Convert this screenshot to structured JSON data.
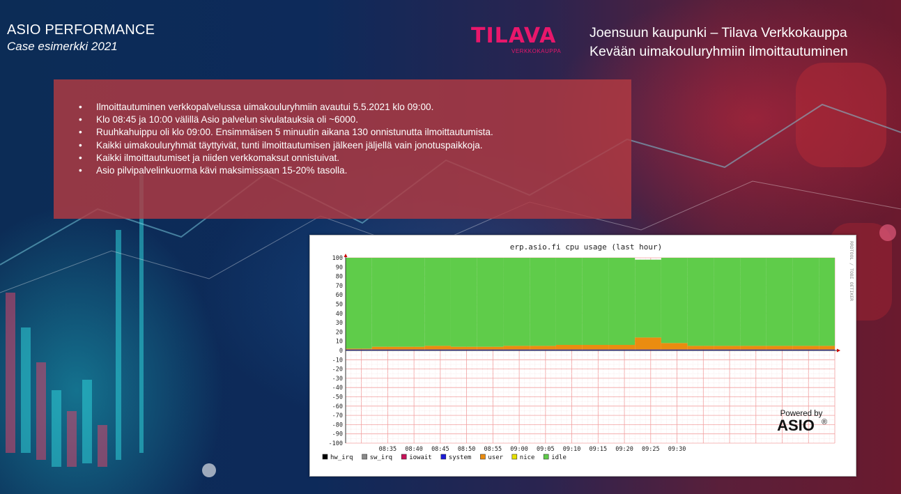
{
  "header": {
    "title": "ASIO PERFORMANCE",
    "subtitle": "Case esimerkki 2021",
    "right_line1": "Joensuun kaupunki – Tilava Verkkokauppa",
    "right_line2": "Kevään uimakouluryhmiin ilmoittautuminen"
  },
  "logo": {
    "text": "TILAVA",
    "subtext": "VERKKOKAUPPA",
    "color": "#e8176b"
  },
  "bullets": [
    "Ilmoittautuminen verkkopalvelussa uimakouluryhmiin avautui 5.5.2021 klo 09:00.",
    "Klo 08:45 ja 10:00 välillä Asio palvelun sivulatauksia oli ~6000.",
    "Ruuhkahuippu oli klo 09:00. Ensimmäisen 5 minuutin aikana 130 onnistunutta ilmoittautumista.",
    "Kaikki uimakouluryhmät täyttyivät, tunti ilmoittautumisen jälkeen jäljellä vain jonotuspaikkoja.",
    "Kaikki ilmoittautumiset ja niiden verkkomaksut onnistuivat.",
    "Asio pilvipalvelinkuorma kävi maksimissaan 15-20% tasolla."
  ],
  "bullet_symbol": "•",
  "chart_data": {
    "type": "area",
    "title": "erp.asio.fi cpu usage (last hour)",
    "side_label": "RRDTOOL / TOBI OETIKER",
    "ylim": [
      -100,
      100
    ],
    "y_ticks": [
      "100",
      "90",
      "80",
      "70",
      "60",
      "50",
      "40",
      "30",
      "20",
      "10",
      "0",
      "-10",
      "-20",
      "-30",
      "-40",
      "-50",
      "-60",
      "-70",
      "-80",
      "-90",
      "-100"
    ],
    "x_ticks": [
      "08:35",
      "08:40",
      "08:45",
      "08:50",
      "08:55",
      "09:00",
      "09:05",
      "09:10",
      "09:15",
      "09:20",
      "09:25",
      "09:30"
    ],
    "x_range_minutes": [
      -33,
      60
    ],
    "grid": true,
    "legend_position": "bottom-left",
    "segments_minutes": [
      -33,
      -28,
      -23,
      -18,
      -13,
      -8,
      -3,
      2,
      7,
      12,
      17,
      22,
      27,
      32,
      37,
      42,
      47,
      52,
      57,
      60
    ],
    "series": [
      {
        "name": "hw_irq",
        "color": "#000000",
        "values": [
          0,
          0,
          0,
          0,
          0,
          0,
          0,
          0,
          0,
          0,
          0,
          0,
          0,
          0,
          0,
          0,
          0,
          0,
          0
        ]
      },
      {
        "name": "sw_irq",
        "color": "#8a8a8a",
        "values": [
          0,
          0,
          0,
          0,
          0,
          0,
          0,
          0,
          0,
          0,
          0,
          0,
          0,
          0,
          0,
          0,
          0,
          0,
          0
        ]
      },
      {
        "name": "iowait",
        "color": "#c8125a",
        "values": [
          0,
          0,
          0,
          0,
          0,
          0,
          0,
          0,
          0,
          0,
          0,
          0,
          0,
          0,
          0,
          0,
          0,
          0,
          0
        ]
      },
      {
        "name": "system",
        "color": "#1a1ad8",
        "values": [
          1,
          1,
          1,
          1,
          1,
          1,
          1,
          1,
          1,
          1,
          1,
          1,
          1,
          1,
          1,
          1,
          1,
          1,
          1
        ]
      },
      {
        "name": "user",
        "color": "#ea8c10",
        "values": [
          1,
          3,
          3,
          4,
          3,
          3,
          4,
          4,
          5,
          5,
          5,
          13,
          7,
          4,
          4,
          4,
          4,
          4,
          4
        ]
      },
      {
        "name": "nice",
        "color": "#e6e000",
        "values": [
          0,
          0,
          0,
          0,
          0,
          0,
          0,
          0,
          0,
          0,
          0,
          0,
          0,
          0,
          0,
          0,
          0,
          0,
          0
        ]
      },
      {
        "name": "idle",
        "color": "#5fcc4a",
        "values": [
          98,
          96,
          96,
          95,
          96,
          96,
          95,
          95,
          94,
          94,
          94,
          84,
          92,
          95,
          95,
          95,
          95,
          95,
          95
        ]
      }
    ],
    "powered_by_line1": "Powered by",
    "powered_by_line2": "ASIO",
    "powered_by_mark": "®"
  }
}
